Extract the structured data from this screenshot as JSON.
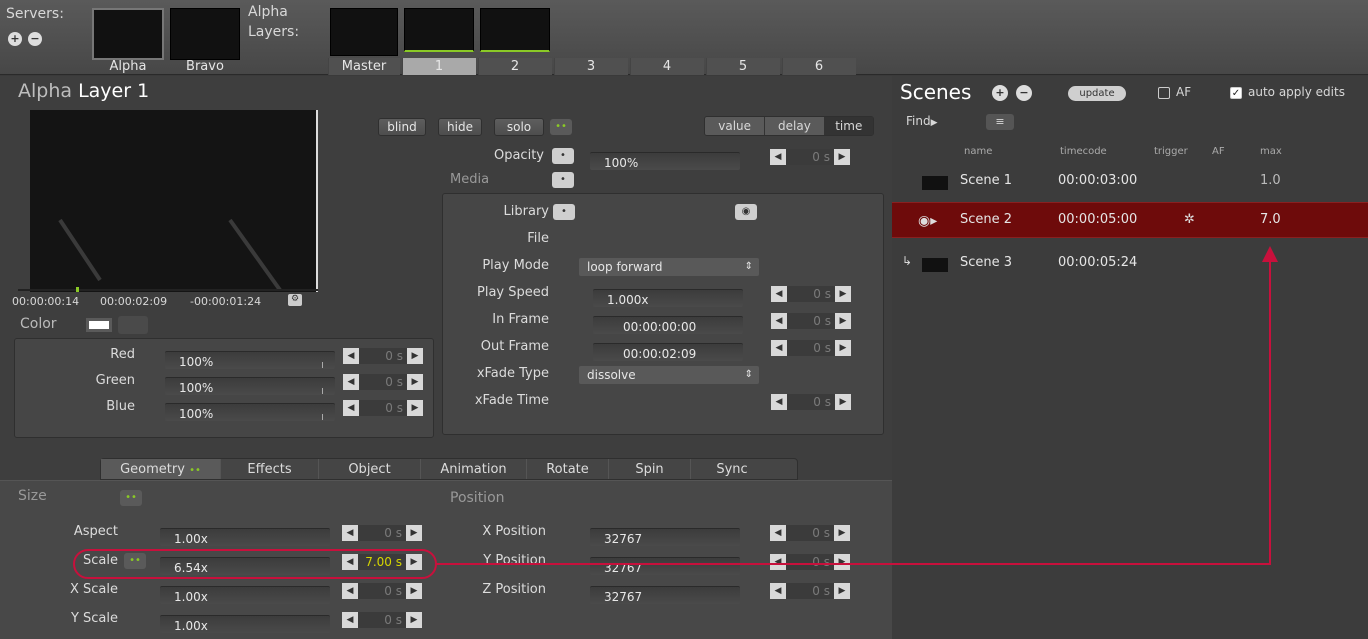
{
  "top": {
    "servers_label": "Servers:",
    "server_names": [
      "Alpha",
      "Bravo"
    ],
    "layers_title": "Alpha",
    "layers_label": "Layers:",
    "layer_tabs": [
      "Master",
      "1",
      "2",
      "3",
      "4",
      "5",
      "6"
    ]
  },
  "layer": {
    "server": "Alpha",
    "title": "Layer 1",
    "buttons": {
      "blind": "blind",
      "hide": "hide",
      "solo": "solo"
    },
    "time_tabs": [
      "value",
      "delay",
      "time"
    ],
    "timecodes": {
      "current": "00:00:00:14",
      "duration": "00:00:02:09",
      "remaining": "-00:00:01:24"
    },
    "color_label": "Color",
    "opacity_label": "Opacity",
    "opacity_value": "100%",
    "media_label": "Media",
    "fade_value": "0 s"
  },
  "color_rows": [
    {
      "label": "Red",
      "value": "100%"
    },
    {
      "label": "Green",
      "value": "100%"
    },
    {
      "label": "Blue",
      "value": "100%"
    }
  ],
  "media_rows": {
    "library": "Library",
    "file": "File",
    "play_mode": "Play Mode",
    "play_mode_value": "loop forward",
    "play_speed": "Play Speed",
    "play_speed_value": "1.000x",
    "in_frame": "In Frame",
    "in_frame_value": "00:00:00:00",
    "out_frame": "Out Frame",
    "out_frame_value": "00:00:02:09",
    "xfade_type": "xFade Type",
    "xfade_type_value": "dissolve",
    "xfade_time": "xFade Time"
  },
  "tabs": [
    "Geometry",
    "Effects",
    "Object",
    "Animation",
    "Rotate",
    "Spin",
    "Sync"
  ],
  "size": {
    "label": "Size",
    "rows": [
      {
        "label": "Aspect",
        "value": "1.00x",
        "fade": "0 s"
      },
      {
        "label": "Scale",
        "value": "6.54x",
        "fade": "7.00 s"
      },
      {
        "label": "X Scale",
        "value": "1.00x",
        "fade": "0 s"
      },
      {
        "label": "Y Scale",
        "value": "1.00x",
        "fade": "0 s"
      }
    ]
  },
  "position": {
    "label": "Position",
    "rows": [
      {
        "label": "X Position",
        "value": "32767"
      },
      {
        "label": "Y Position",
        "value": "32767"
      },
      {
        "label": "Z Position",
        "value": "32767"
      }
    ],
    "fade": "0 s"
  },
  "scenes": {
    "title": "Scenes",
    "update": "update",
    "af": "AF",
    "auto_apply": "auto apply edits",
    "find": "Find",
    "columns": [
      "name",
      "timecode",
      "trigger",
      "AF",
      "max"
    ],
    "rows": [
      {
        "name": "Scene 1",
        "timecode": "00:00:03:00",
        "max": "1.0"
      },
      {
        "name": "Scene 2",
        "timecode": "00:00:05:00",
        "max": "7.0"
      },
      {
        "name": "Scene 3",
        "timecode": "00:00:05:24",
        "max": ""
      }
    ]
  },
  "colors": {
    "selected_row": "#6e0b0b",
    "annotation": "#c8103c",
    "bg": "#3e3e3e"
  }
}
